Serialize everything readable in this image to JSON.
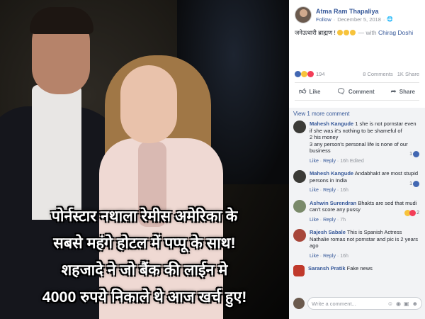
{
  "photo": {
    "caption_lines": [
      "पोर्नस्टार नथाला रेमीस अमेरिका के",
      "सबसे महंगे होटल में पप्पू के साथ!",
      "शहजादे ने जो बैंक की लाईन मे",
      "4000 रुपये निकाले थे आज खर्च हुए!"
    ]
  },
  "post": {
    "author": "Atma Ram Thapaliya",
    "follow": "Follow",
    "date": "December 5, 2018",
    "text": "जनेऊधारी ब्राह्मण !",
    "with_label": "— with",
    "tagged": "Chirag Doshi",
    "reaction_count": "194",
    "comments_count": "8 Comments",
    "shares_count": "1K Share",
    "actions": {
      "like": "Like",
      "comment": "Comment",
      "share": "Share"
    }
  },
  "comments": {
    "view_more": "View 1 more comment",
    "items": [
      {
        "name": "Mahesh Kangude",
        "text": "1 she is not pornstar even if she was it's nothing to be shameful of\n2 his money\n3 any person's personal life is none of our business",
        "like": "Like",
        "reply": "Reply",
        "time": "16h",
        "edited": "Edited",
        "reaction": "1",
        "avatar_color": "#3b3a36"
      },
      {
        "name": "Mahesh Kangude",
        "text": "Andabhakt are most stupid persons in India",
        "like": "Like",
        "reply": "Reply",
        "time": "16h",
        "edited": "",
        "reaction": "1",
        "avatar_color": "#3b3a36"
      },
      {
        "name": "Ashwin Surendran",
        "text": "Bhakts are sed that mudi can't score any pussy",
        "like": "Like",
        "reply": "Reply",
        "time": "7h",
        "edited": "",
        "reaction": "2",
        "avatar_color": "#7a8a6a"
      },
      {
        "name": "Rajesh Sabale",
        "text": "This is Spanish Actress Nathalie romas not pornstar and pic is 2 years ago",
        "like": "Like",
        "reply": "Reply",
        "time": "16h",
        "edited": "",
        "reaction": "",
        "avatar_color": "#a7463a"
      },
      {
        "name": "Saransh Pratik",
        "text": "Fake news",
        "like": "",
        "reply": "",
        "time": "",
        "edited": "",
        "reaction": "",
        "avatar_color": "#c0392b"
      }
    ],
    "write_placeholder": "Write a comment..."
  },
  "colors": {
    "link_blue": "#365899",
    "like_blue": "#4267b2",
    "panel_bg": "#ffffff",
    "comments_bg": "#f2f3f5"
  }
}
